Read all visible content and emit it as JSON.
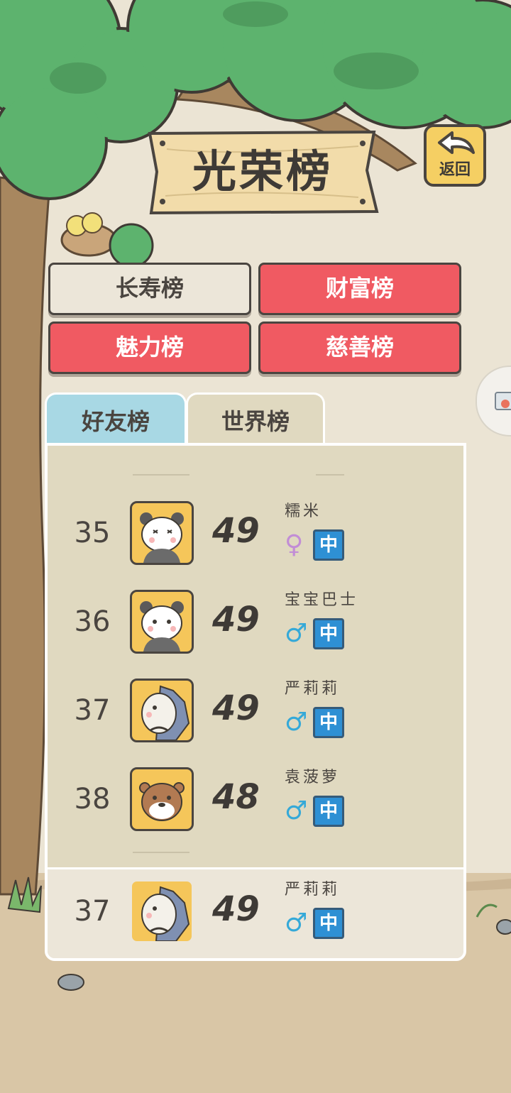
{
  "header": {
    "title": "光荣榜",
    "back_label": "返回"
  },
  "categories": [
    {
      "label": "长寿榜",
      "active": true
    },
    {
      "label": "财富榜",
      "active": false
    },
    {
      "label": "魅力榜",
      "active": false
    },
    {
      "label": "慈善榜",
      "active": false
    }
  ],
  "tabs": [
    {
      "label": "好友榜",
      "active": false
    },
    {
      "label": "世界榜",
      "active": true
    }
  ],
  "rows": [
    {
      "rank": "35",
      "score": "49",
      "name": "糯米",
      "gender": "♀",
      "badge": "中",
      "avatar": "panda"
    },
    {
      "rank": "36",
      "score": "49",
      "name": "宝宝巴士",
      "gender": "♂",
      "badge": "中",
      "avatar": "panda"
    },
    {
      "rank": "37",
      "score": "49",
      "name": "严莉莉",
      "gender": "♂",
      "badge": "中",
      "avatar": "hedgehog"
    },
    {
      "rank": "38",
      "score": "48",
      "name": "袁菠萝",
      "gender": "♂",
      "badge": "中",
      "avatar": "otter"
    }
  ],
  "my_row": {
    "rank": "37",
    "score": "49",
    "name": "严莉莉",
    "gender": "♂",
    "badge": "中",
    "avatar": "hedgehog"
  },
  "colors": {
    "tree_green": "#5db36e",
    "active_tab": "#e0d9c0",
    "friends_tab": "#a8d8e4",
    "red_button": "#f05a62",
    "badge_blue": "#2e90d4",
    "sign_wood": "#f2dcaa"
  }
}
